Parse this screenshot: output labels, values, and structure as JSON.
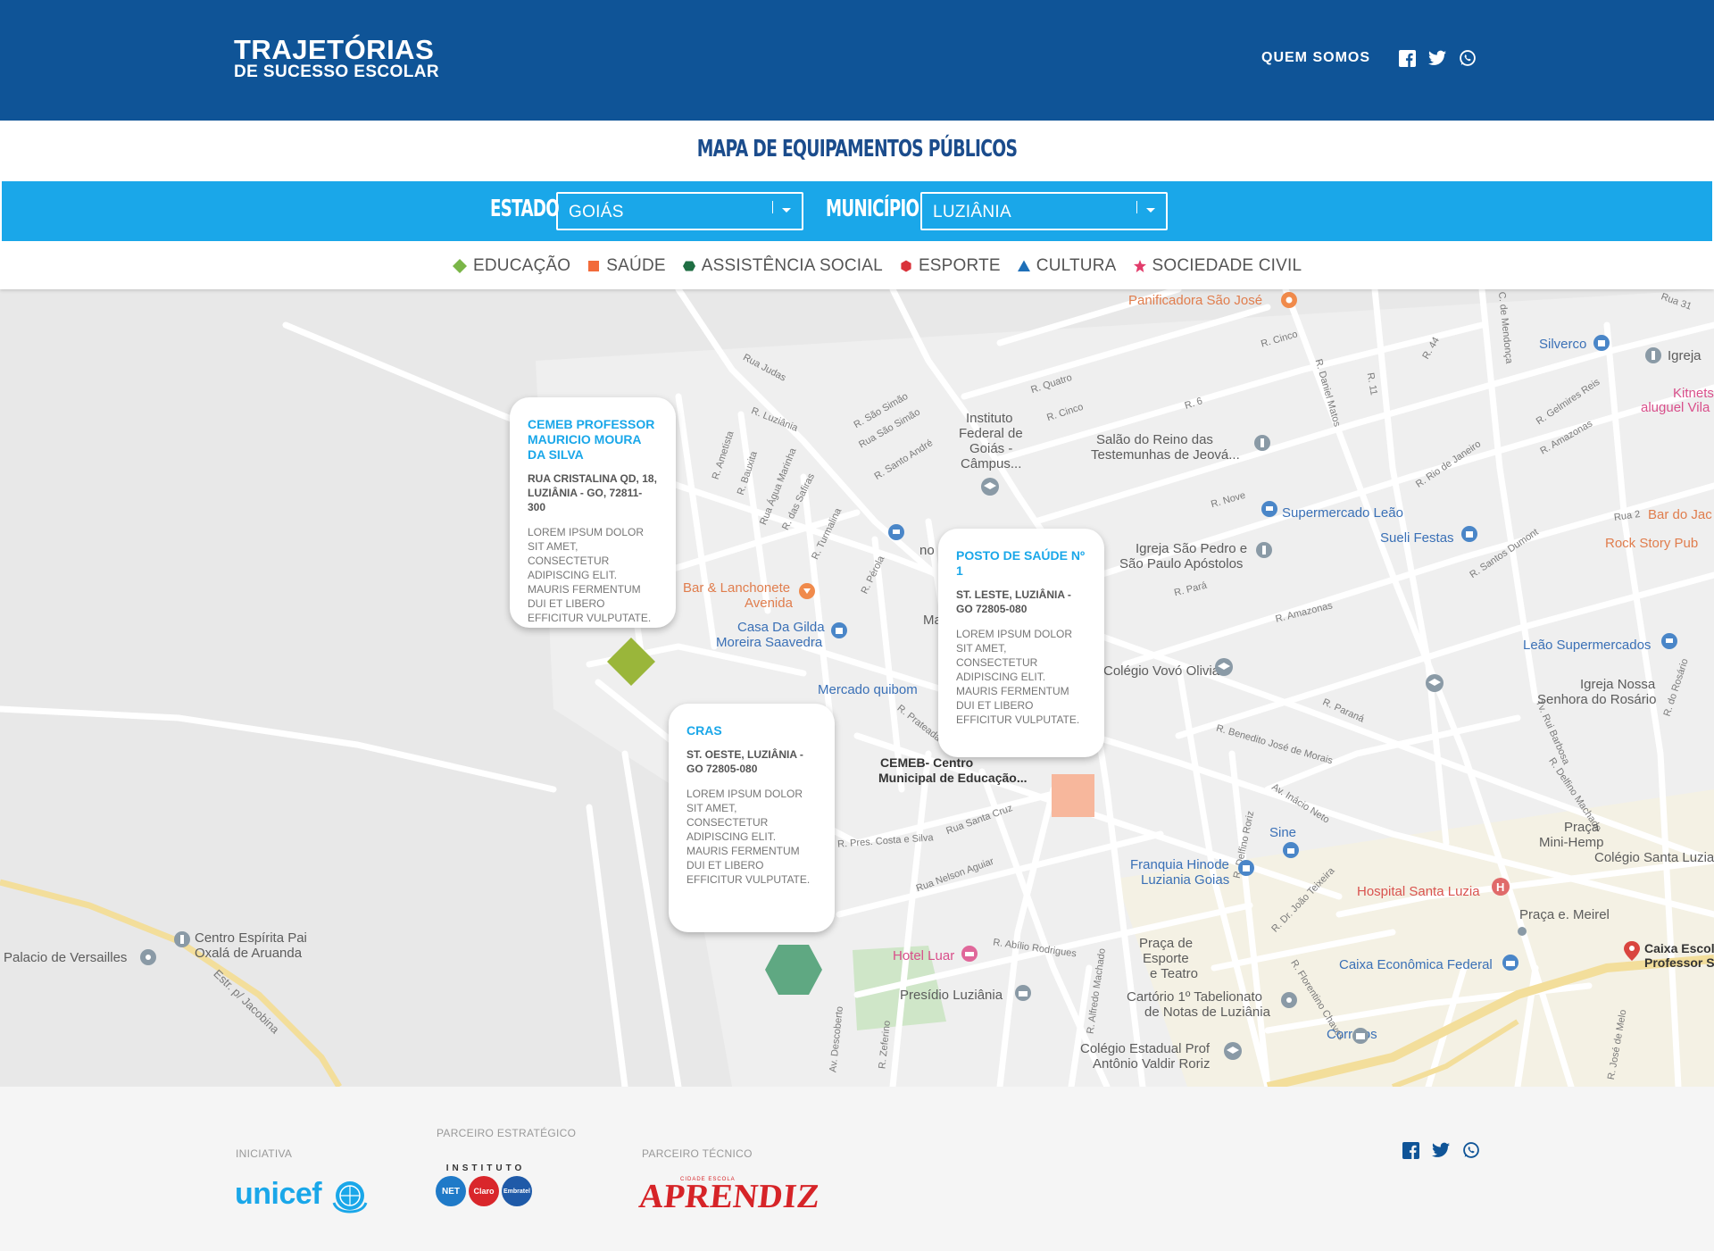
{
  "header": {
    "logo_line1": "TRAJETÓRIAS",
    "logo_line2": "DE SUCESSO ESCOLAR",
    "nav_about": "QUEM SOMOS",
    "social_icons": [
      "facebook-icon",
      "twitter-icon",
      "whatsapp-icon"
    ]
  },
  "page_title": "MAPA DE EQUIPAMENTOS PÚBLICOS",
  "filters": {
    "state_label": "ESTADO",
    "state_value": "GOIÁS",
    "city_label": "MUNICÍPIO",
    "city_value": "LUZIÂNIA"
  },
  "legend": [
    {
      "label": "EDUCAÇÃO",
      "icon": "diamond-icon",
      "color": "#7ab648"
    },
    {
      "label": "SAÚDE",
      "icon": "square-icon",
      "color": "#f26b3a"
    },
    {
      "label": "ASSISTÊNCIA SOCIAL",
      "icon": "hexagon-icon",
      "color": "#1f6e43"
    },
    {
      "label": "ESPORTE",
      "icon": "hexagon-icon",
      "color": "#d9323a"
    },
    {
      "label": "CULTURA",
      "icon": "triangle-icon",
      "color": "#1e6fb8"
    },
    {
      "label": "SOCIEDADE CIVIL",
      "icon": "star-icon",
      "color": "#e23c6b"
    }
  ],
  "map": {
    "pois": {
      "panificadora": "Panificadora São José",
      "silverco": "Silverco",
      "igreja": "Igreja",
      "kitnets1": "Kitnets",
      "kitnets2": "aluguel Vila",
      "instituto1": "Instituto",
      "instituto2": "Federal de",
      "instituto3": "Goiás -",
      "instituto4": "Câmpus...",
      "salao1": "Salão do Reino das",
      "salao2": "Testemunhas de Jeová...",
      "supermercado_leao": "Supermercado Leão",
      "bar_jac": "Bar do Jac",
      "rock": "Rock Story Pub",
      "sueli": "Sueli Festas",
      "igreja_sp1": "Igreja São Pedro e",
      "igreja_sp2": "São Paulo Apóstolos",
      "bar_lanch1": "Bar & Lanchonete",
      "bar_lanch2": "Avenida",
      "casa1": "Casa Da Gilda",
      "casa2": "Moreira Saavedra",
      "leao_super": "Leão Supermercados",
      "igreja_nossa1": "Igreja Nossa",
      "igreja_nossa2": "Senhora do Rosário",
      "mercado": "Mercado quibom",
      "colegio_vovo": "Colégio Vovó Olivia",
      "cemeb1": "CEMEB- Centro",
      "cemeb2": "Municipal de Educação...",
      "sine": "Sine",
      "praca1": "Praça",
      "praca2": "Mini-Hemp",
      "colegio_sl": "Colégio Santa Luzia",
      "franquia1": "Franquia Hinode",
      "franquia2": "Luziania Goias",
      "hospital": "Hospital Santa Luzia",
      "praca_meirel": "Praça e. Meirel",
      "centro1": "Centro Espírita Pai",
      "centro2": "Oxalá de Aruanda",
      "versailles": "Palacio de Versailles",
      "hotel": "Hotel Luar",
      "presidio": "Presídio Luziânia",
      "praca_esp1": "Praça de",
      "praca_esp2": "Esporte",
      "praca_esp3": "e Teatro",
      "caixa": "Caixa Econômica Federal",
      "caixa_esc1": "Caixa Escol",
      "caixa_esc2": "Professor S",
      "cartorio1": "Cartório 1º Tabelionato",
      "cartorio2": "de Notas de Luziânia",
      "correios": "Correios",
      "colegio_est1": "Colégio Estadual Prof",
      "colegio_est2": "Antônio Valdir Roriz",
      "no": "no",
      "ma": "Ma"
    },
    "streets": {
      "judas": "Rua Judas",
      "luziania": "R. Luziânia",
      "sao_simao1": "R. São Simão",
      "sao_simao2": "Rua São Simão",
      "santo_andre": "R. Santo André",
      "ametista": "R. Ametista",
      "bauxita": "R. Bauxita",
      "agua_marinha": "Rua Água Marinha",
      "safiras": "R. das Safiras",
      "turmalina": "R. Turmalina",
      "perola": "R. Pérola",
      "quatro": "R. Quatro",
      "cinco": "R. Cinco",
      "cinco2": "R. Cinco",
      "seis": "R. 6",
      "nove": "R. Nove",
      "para": "R. Pará",
      "amazonas": "R. Amazonas",
      "amazonas2": "R. Amazonas",
      "daniel": "R. Daniel Matos",
      "onze": "R. 11",
      "quarenta": "R. 44",
      "mendonca": "R. C. de Mendonça",
      "trinta_um": "Rua 31",
      "gelmires": "R. Gelmires Reis",
      "rio_janeiro": "R. Rio de Janeiro",
      "santos_dumont": "R. Santos Dumont",
      "rua2": "Rua 2",
      "prateada": "R. Prateada",
      "benedito": "R. Benedito José de Morais",
      "parana": "R. Paraná",
      "inacio": "Av. Inácio Neto",
      "delfino": "R. Delfino Roriz",
      "delfino_machado": "R. Delfino Machado",
      "barbosa": "Tv. Rui Barbosa",
      "rosario": "R. do Rosário",
      "pres_costa": "R. Pres. Costa e Silva",
      "santa_cruz": "Rua Santa Cruz",
      "nelson": "Rua Nelson Aguiar",
      "abilio": "R. Abílio Rodrigues",
      "alfredo": "R. Alfredo Machado",
      "joao_teixeira": "R. Dr. João Teixeira",
      "florentino": "R. Florentino Chaves",
      "descoberto": "Av. Descoberto",
      "zeferino": "R. Zeferino",
      "jose_melo": "R. José de Melo",
      "jacobina": "Estr. p/ Jacobina"
    }
  },
  "cards": [
    {
      "title": "CEMEB PROFESSOR MAURICIO MOURA DA SILVA",
      "address": "RUA CRISTALINA QD, 18, LUZIÂNIA - GO, 72811-300",
      "description": "LOREM IPSUM DOLOR SIT AMET, CONSECTETUR ADIPISCING ELIT. MAURIS FERMENTUM DUI ET LIBERO EFFICITUR VULPUTATE."
    },
    {
      "title": "POSTO DE SAÚDE Nº 1",
      "address": "ST. LESTE, LUZIÂNIA - GO 72805-080",
      "description": "LOREM IPSUM DOLOR SIT AMET, CONSECTETUR ADIPISCING ELIT. MAURIS FERMENTUM DUI ET LIBERO EFFICITUR VULPUTATE."
    },
    {
      "title": "CRAS",
      "address": "ST. OESTE, LUZIÂNIA - GO 72805-080",
      "description": "LOREM IPSUM DOLOR SIT AMET, CONSECTETUR ADIPISCING ELIT. MAURIS FERMENTUM DUI ET LIBERO EFFICITUR VULPUTATE."
    }
  ],
  "footer": {
    "initiative_label": "INICIATIVA",
    "initiative_name": "unicef",
    "strategic_label": "PARCEIRO ESTRATÉGICO",
    "strategic_name": "INSTITUTO",
    "strategic_badges": [
      "NET",
      "Claro",
      "Embratel"
    ],
    "technical_label": "PARCEIRO TÉCNICO",
    "technical_name": "APRENDIZ",
    "technical_small": "CIDADE ESCOLA"
  },
  "colors": {
    "header_bg": "#0f5497",
    "filter_bg": "#1aa7e9",
    "title_color": "#1b4c8c",
    "card_title": "#1aa7e9",
    "marker_education": "#9ab63a",
    "marker_health": "#f7b79c",
    "marker_social": "#5fa882"
  }
}
